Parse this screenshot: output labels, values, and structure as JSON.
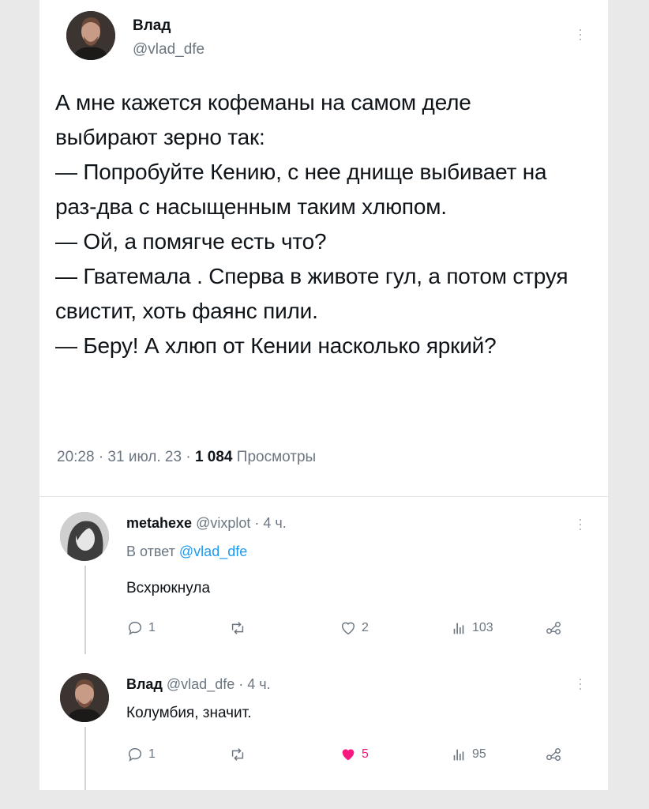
{
  "main_tweet": {
    "author_name": "Влад",
    "author_handle": "@vlad_dfe",
    "text": "А мне кажется кофеманы на самом деле выбирают зерно так:\n— Попробуйте Кению, с нее днище выбивает на раз-два с насыщенным таким хлюпом.\n— Ой, а помягче есть что?\n— Гватемала . Сперва в животе гул, а потом струя свистит, хоть фаянс пили.\n— Беру! А хлюп от Кении насколько яркий?",
    "time": "20:28 · 31 июл. 23 · ",
    "views_count": "1 084",
    "views_label": "Просмотры"
  },
  "replies": [
    {
      "author_name": "metahexe",
      "author_handle": "@vixplot · 4 ч.",
      "reply_prefix": "В ответ",
      "reply_to": "@vlad_dfe",
      "text": "Всхрюкнула",
      "comments": "1",
      "retweets": "",
      "likes": "2",
      "views": "103",
      "liked": false
    },
    {
      "author_name": "Влад",
      "author_handle": "@vlad_dfe · 4 ч.",
      "text": "Колумбия, значит.",
      "comments": "1",
      "retweets": "",
      "likes": "5",
      "views": "95",
      "liked": true
    }
  ],
  "colors": {
    "like_active": "#f91880",
    "link": "#1d9bf0",
    "muted": "#6b7680"
  }
}
